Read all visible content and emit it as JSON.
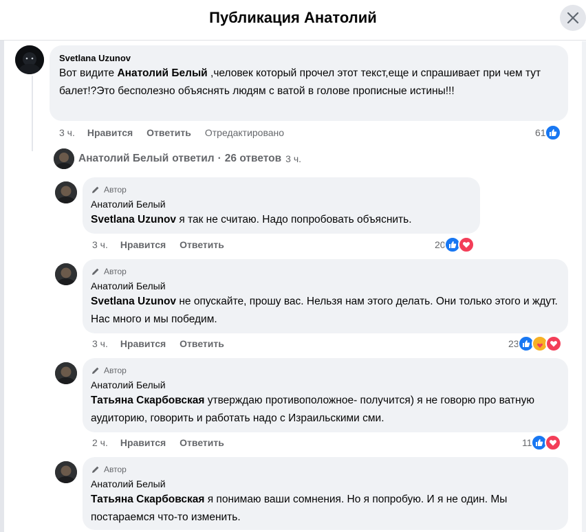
{
  "header": {
    "title": "Публикация Анатолий"
  },
  "main_comment": {
    "author": "Svetlana Uzunov",
    "text_before": "Вот видите ",
    "mention": "Анатолий Белый",
    "text_after": " ,человек который прочел этот текст,еще и спрашивает при чем тут балет!?Это бесполезно объяснять людям с ватой в голове прописные истины!!!",
    "time": "3 ч.",
    "like_label": "Нравится",
    "reply_label": "Ответить",
    "edited_label": "Отредактировано",
    "reaction_count": "61",
    "reactions": [
      "like-icon"
    ]
  },
  "replies_summary": {
    "name": "Анатолий Белый",
    "action": "ответил",
    "separator": "·",
    "count_text": "26 ответов",
    "time": "3 ч."
  },
  "replies": [
    {
      "badge": "Автор",
      "author": "Анатолий Белый",
      "mention": "Svetlana Uzunov",
      "text": " я так не считаю. Надо попробовать объяснить.",
      "time": "3 ч.",
      "like_label": "Нравится",
      "reply_label": "Ответить",
      "reaction_count": "20",
      "reactions": [
        "like-icon",
        "love-icon"
      ]
    },
    {
      "badge": "Автор",
      "author": "Анатолий Белый",
      "mention": "Svetlana Uzunov",
      "text": " не опускайте, прошу вас. Нельзя нам этого делать. Они только этого и ждут. Нас много и мы победим.",
      "time": "3 ч.",
      "like_label": "Нравится",
      "reply_label": "Ответить",
      "reaction_count": "23",
      "reactions": [
        "like-icon",
        "care-icon",
        "love-icon"
      ]
    },
    {
      "badge": "Автор",
      "author": "Анатолий Белый",
      "mention": "Татьяна Скарбовская",
      "text": " утверждаю противоположное- получится) я не говорю про ватную аудиторию, говорить и работать надо с Израильскими сми.",
      "time": "2 ч.",
      "like_label": "Нравится",
      "reply_label": "Ответить",
      "reaction_count": "11",
      "reactions": [
        "like-icon",
        "love-icon"
      ]
    },
    {
      "badge": "Автор",
      "author": "Анатолий Белый",
      "mention": "Татьяна Скарбовская",
      "text": " я понимаю ваши сомнения. Но я попробую. И я не один. Мы постараемся что-то изменить.",
      "time": "",
      "like_label": "",
      "reply_label": "",
      "reaction_count": "",
      "reactions": []
    }
  ],
  "colors": {
    "bubble": "#f0f2f5",
    "secondary_text": "#65676b",
    "like": "#1877f2",
    "love": "#f33e58",
    "care": "#f7b125"
  }
}
